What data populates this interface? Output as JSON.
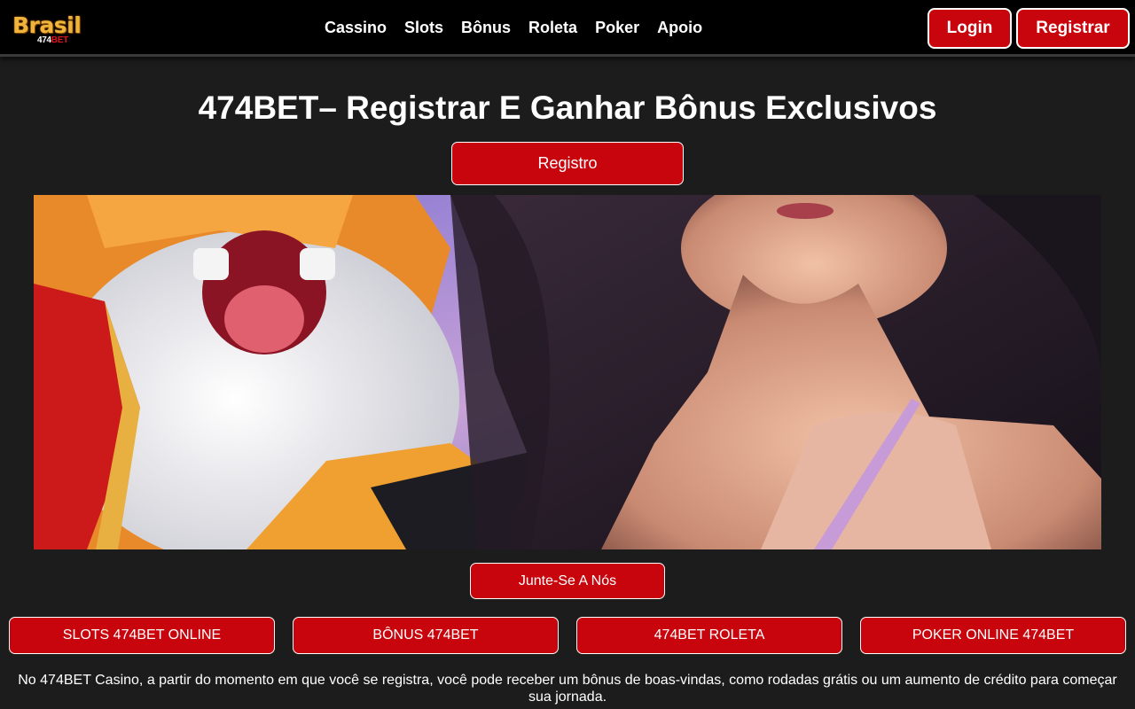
{
  "header": {
    "logo": {
      "word": "Brasil",
      "sub_prefix": "474",
      "sub_suffix": "BET"
    },
    "nav": [
      "Cassino",
      "Slots",
      "Bônus",
      "Roleta",
      "Poker",
      "Apoio"
    ],
    "login_label": "Login",
    "register_label": "Registrar"
  },
  "main": {
    "title": "474BET– Registrar E Ganhar Bônus Exclusivos",
    "registro_label": "Registro",
    "join_label": "Junte-Se A Nós",
    "categories": [
      "SLOTS 474BET ONLINE",
      "BÔNUS 474BET",
      "474BET ROLETA",
      "POKER ONLINE 474BET"
    ],
    "description": "No 474BET Casino, a partir do momento em que você se registra, você pode receber um bônus de boas-vindas, como rodadas grátis ou um aumento de crédito para começar sua jornada."
  },
  "colors": {
    "background": "#1c1c1c",
    "header": "#000000",
    "accent_red": "#c8050c",
    "logo_gold": "#f0b43c"
  }
}
